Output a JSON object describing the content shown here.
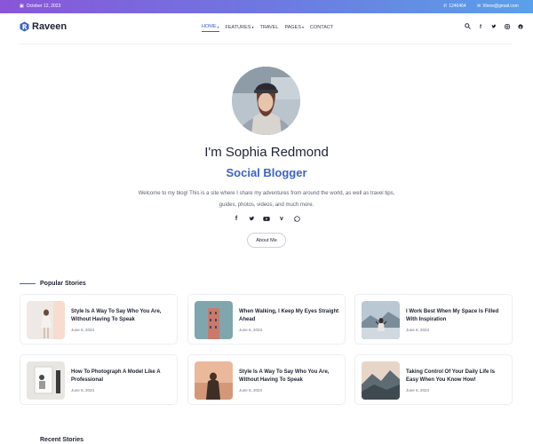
{
  "topbar": {
    "date": "October 12, 2023",
    "phone": "1246464",
    "email": "Xlnne@gmail.com",
    "date_icon": "calendar-icon",
    "phone_icon": "phone-icon",
    "email_icon": "mail-icon"
  },
  "header": {
    "brand": "Raveen",
    "nav": [
      {
        "label": "HOME",
        "has_caret": true
      },
      {
        "label": "FEATURES",
        "has_caret": true
      },
      {
        "label": "TRAVEL",
        "has_caret": false
      },
      {
        "label": "PAGES",
        "has_caret": true
      },
      {
        "label": "CONTACT",
        "has_caret": false
      }
    ],
    "icons": [
      "search-icon",
      "facebook-icon",
      "twitter-icon",
      "instagram-icon",
      "pinterest-icon"
    ]
  },
  "hero": {
    "name": "I'm Sophia Redmond",
    "role": "Social Blogger",
    "description": "Welcome to my blog! This is a site where I share my adventures from around the world, as well as travel tips, guides, photos, videos, and much more.",
    "socials": [
      "facebook-icon",
      "twitter-icon",
      "youtube-icon",
      "vimeo-icon",
      "whatsapp-icon"
    ],
    "about_label": "About Me"
  },
  "popular": {
    "title": "Popular Stories",
    "cards": [
      {
        "title": "Style Is A Way To Say Who You Are, Without Having To Speak",
        "date": "June 6, 2023"
      },
      {
        "title": "When Walking, I Keep My Eyes Straight Ahead",
        "date": "June 6, 2023"
      },
      {
        "title": "I Work Best When My Space Is Filled With Inspiration",
        "date": "June 6, 2023"
      },
      {
        "title": "How To Photograph A Model Like A Professional",
        "date": "June 6, 2023"
      },
      {
        "title": "Style Is A Way To Say Who You Are, Without Having To Speak",
        "date": "June 6, 2023"
      },
      {
        "title": "Taking Control Of Your Daily Life Is Easy When You Know How!",
        "date": "June 6, 2023"
      }
    ]
  },
  "recent": {
    "title": "Recent Stories"
  },
  "colors": {
    "accent": "#3b63c9",
    "topbar_start": "#8a55d9",
    "topbar_end": "#5aa0ea"
  }
}
